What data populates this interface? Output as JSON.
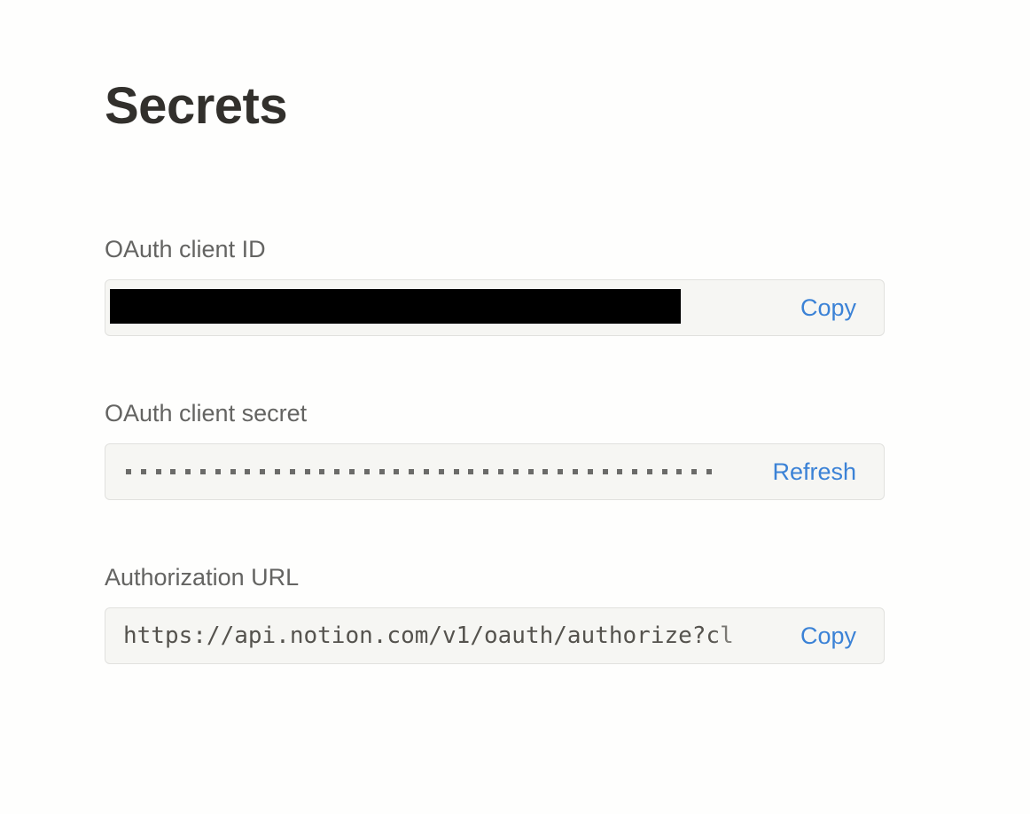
{
  "page": {
    "title": "Secrets"
  },
  "fields": {
    "client_id": {
      "label": "OAuth client ID",
      "value": "[redacted]",
      "action_label": "Copy"
    },
    "client_secret": {
      "label": "OAuth client secret",
      "masked_dot_count": 40,
      "action_label": "Refresh"
    },
    "authorization_url": {
      "label": "Authorization URL",
      "value": "https://api.notion.com/v1/oauth/authorize?cl",
      "action_label": "Copy"
    }
  },
  "colors": {
    "accent": "#3b82d6",
    "field_bg": "#f6f6f3",
    "field_border": "#e1e1de",
    "title": "#32302c",
    "label": "#646462"
  }
}
